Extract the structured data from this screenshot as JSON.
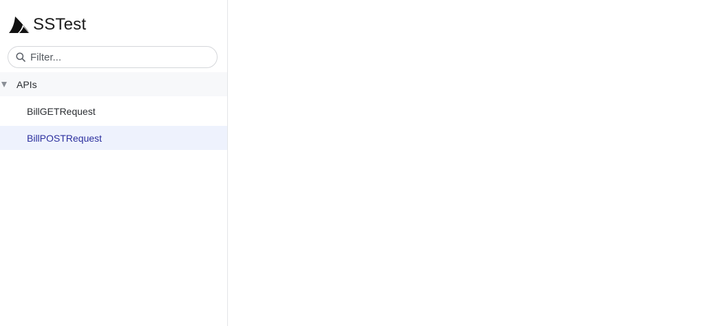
{
  "app": {
    "title": "SSTest"
  },
  "search": {
    "placeholder": "Filter...",
    "value": ""
  },
  "tree": {
    "group": {
      "label": "APIs",
      "expanded": true
    },
    "items": [
      {
        "label": "BillGETRequest",
        "selected": false
      },
      {
        "label": "BillPOSTRequest",
        "selected": true
      }
    ]
  },
  "colors": {
    "selected_bg": "#eef2fd",
    "selected_text": "#2b2f9e",
    "group_bg": "#f7f8fa",
    "border": "#e3e5e8"
  },
  "icons": {
    "logo": "shark-fin-logo-icon",
    "search": "search-icon",
    "caret": "caret-down-icon"
  }
}
